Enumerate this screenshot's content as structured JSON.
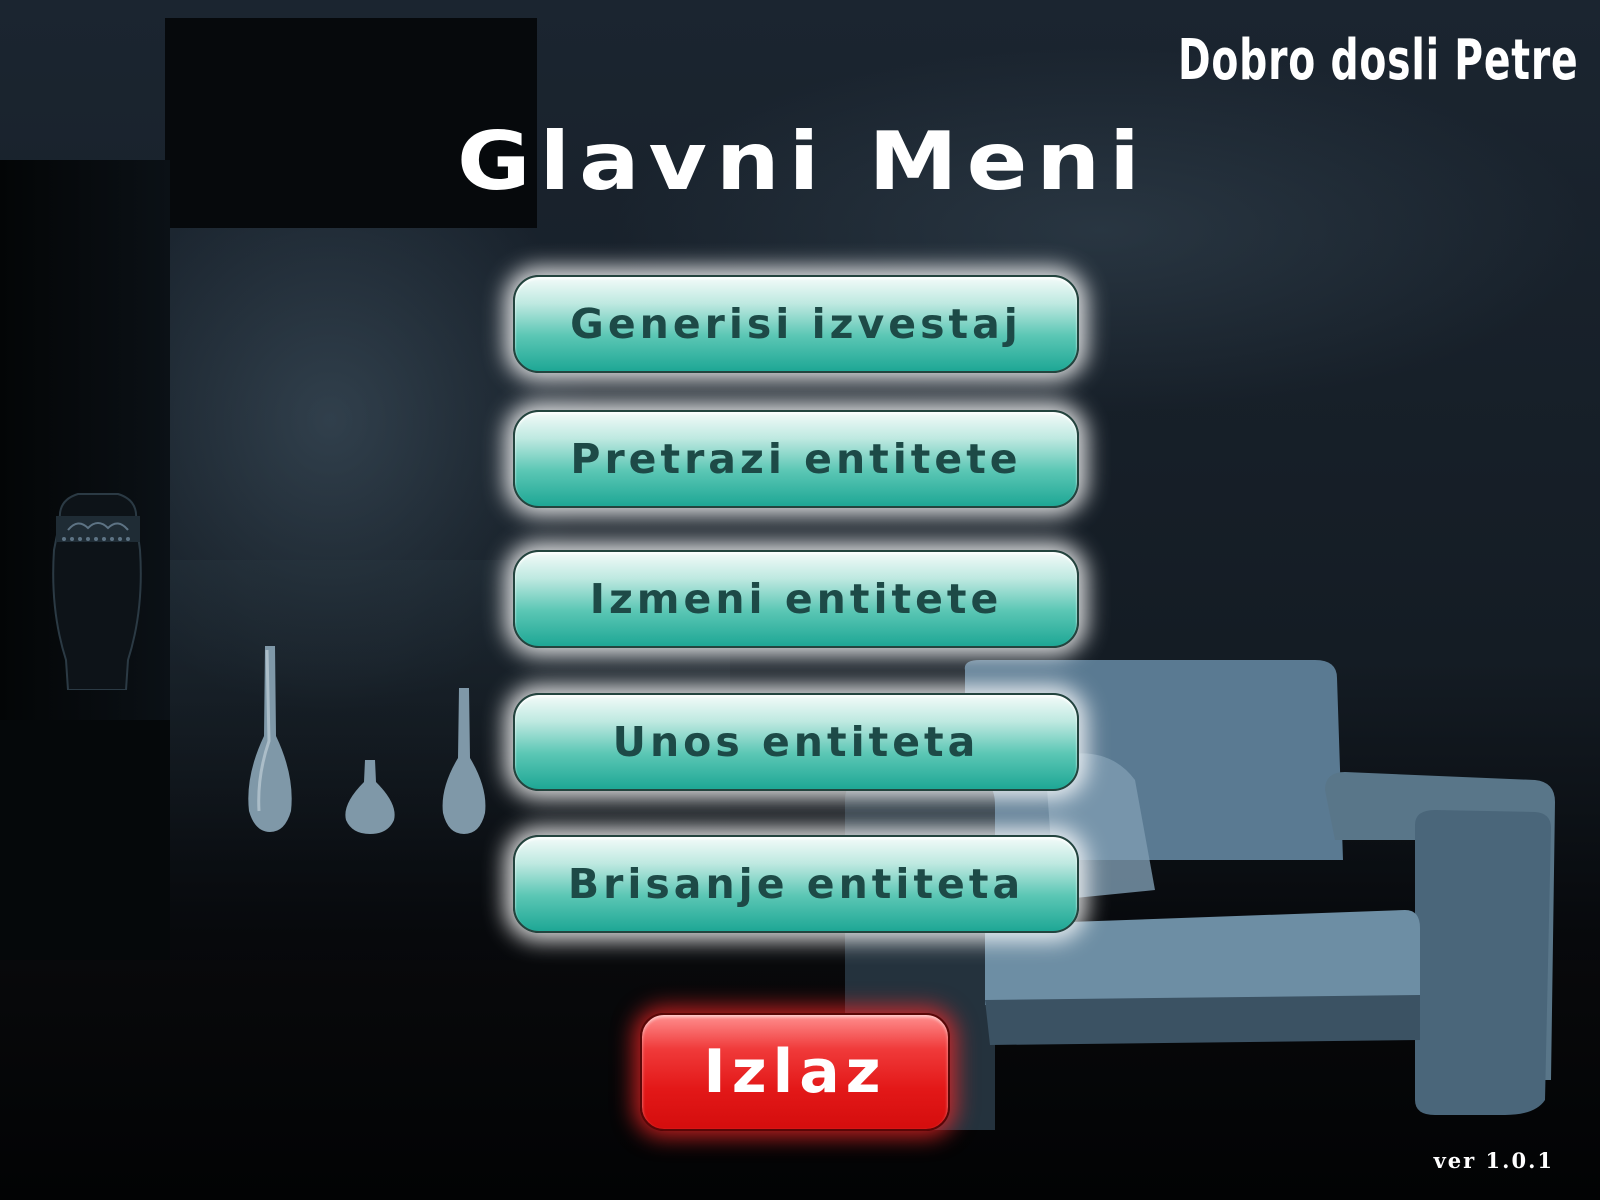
{
  "header": {
    "welcome": "Dobro dosli Petre",
    "title": "Glavni Meni"
  },
  "menu": {
    "items": [
      {
        "label": "Generisi izvestaj"
      },
      {
        "label": "Pretrazi entitete"
      },
      {
        "label": "Izmeni entitete"
      },
      {
        "label": "Unos entiteta"
      },
      {
        "label": "Brisanje entiteta"
      }
    ],
    "exit_label": "Izlaz"
  },
  "footer": {
    "version": "ver 1.0.1"
  },
  "colors": {
    "menu_button": "#1ea795",
    "menu_text": "#1d4a47",
    "exit_button": "#e31818",
    "background": "#141c24"
  }
}
